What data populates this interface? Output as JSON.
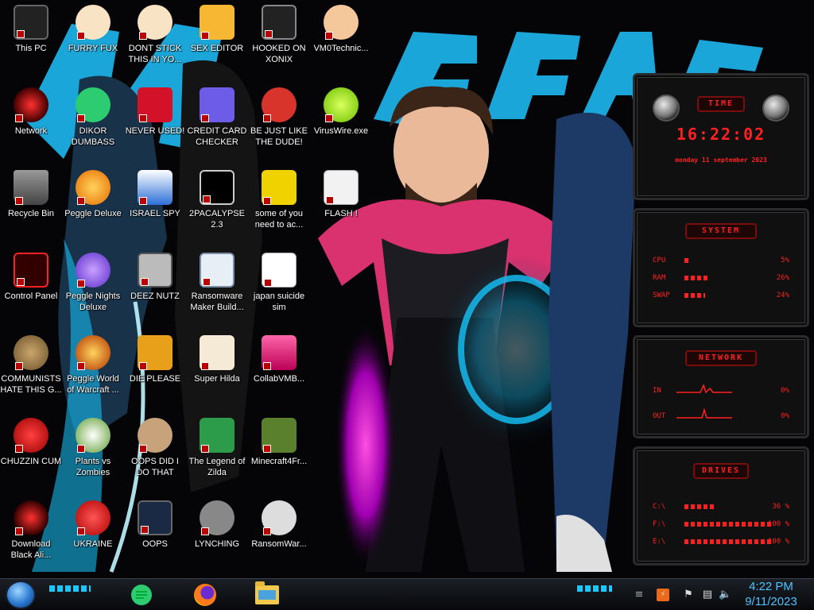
{
  "desktop": {
    "icons": [
      {
        "label": "This PC",
        "icon": "computer-icon"
      },
      {
        "label": "Network",
        "icon": "network-icon"
      },
      {
        "label": "Recycle Bin",
        "icon": "recycle-bin-icon"
      },
      {
        "label": "Control Panel",
        "icon": "control-panel-icon"
      },
      {
        "label": "COMMUNISTS HATE THIS G...",
        "icon": "money-bag-icon"
      },
      {
        "label": "CHUZZIN CUM",
        "icon": "chuzzle-icon"
      },
      {
        "label": "Download Black Ali...",
        "icon": "alien-orb-icon"
      },
      {
        "label": "FURRY FUX",
        "icon": "anime-face-icon"
      },
      {
        "label": "DIKOR DUMBASS",
        "icon": "chat-app-icon"
      },
      {
        "label": "Peggle Deluxe",
        "icon": "peggle-icon"
      },
      {
        "label": "Peggle Nights Deluxe",
        "icon": "peggle-nights-icon"
      },
      {
        "label": "Peggle World of Warcraft ...",
        "icon": "peggle-wow-icon"
      },
      {
        "label": "Plants vs Zombies",
        "icon": "plants-icon"
      },
      {
        "label": "UKRAINE",
        "icon": "radiation-icon"
      },
      {
        "label": "DONT STICK THIS IN YO...",
        "icon": "anime-face-icon"
      },
      {
        "label": "NEVER USED!",
        "icon": "dev-icon"
      },
      {
        "label": "ISRAEL SPY",
        "icon": "spy-icon"
      },
      {
        "label": "DEEZ NUTZ",
        "icon": "windows-stack-icon"
      },
      {
        "label": "DIE PLEASE",
        "icon": "de-icon"
      },
      {
        "label": "OOPS DID I DO THAT",
        "icon": "portrait-icon"
      },
      {
        "label": "OOPS",
        "icon": "monitor-icon"
      },
      {
        "label": "SEX EDITOR",
        "icon": "editor-icon"
      },
      {
        "label": "CREDIT CARD CHECKER",
        "icon": "credit-card-icon"
      },
      {
        "label": "2PACALYPSE 2.3",
        "icon": "terminal-icon"
      },
      {
        "label": "Ransomware Maker Build...",
        "icon": "app-window-icon"
      },
      {
        "label": "Super Hilda",
        "icon": "pixel-icon"
      },
      {
        "label": "The Legend of Zilda",
        "icon": "zelda-icon"
      },
      {
        "label": "LYNCHING",
        "icon": "lynching-icon"
      },
      {
        "label": "HOOKED ON XONIX",
        "icon": "xonix-icon"
      },
      {
        "label": "BE JUST LIKE THE DUDE!",
        "icon": "santa-icon"
      },
      {
        "label": "some of you need to ac...",
        "icon": "bear-icon"
      },
      {
        "label": "japan suicide sim",
        "icon": "file-icon"
      },
      {
        "label": "CollabVMB...",
        "icon": "collab-icon"
      },
      {
        "label": "Minecraft4Fr...",
        "icon": "minecraft-icon"
      },
      {
        "label": "RansomWar...",
        "icon": "skull-icon"
      },
      {
        "label": "VM0Technic...",
        "icon": "technician-icon"
      },
      {
        "label": "VirusWire.exe",
        "icon": "lime-icon"
      },
      {
        "label": "FLASH !",
        "icon": "flash-icon"
      }
    ]
  },
  "widget": {
    "time": {
      "title": "TIME",
      "clock": "16:22:02",
      "date": "monday 11 september 2023"
    },
    "system": {
      "title": "SYSTEM",
      "rows": [
        {
          "label": "CPU",
          "value": "5%",
          "level": 0.05
        },
        {
          "label": "RAM",
          "value": "26%",
          "level": 0.26
        },
        {
          "label": "SWAP",
          "value": "24%",
          "level": 0.24
        }
      ]
    },
    "network": {
      "title": "NETWORK",
      "rows": [
        {
          "label": "IN",
          "value": "0%"
        },
        {
          "label": "OUT",
          "value": "0%"
        }
      ]
    },
    "drives": {
      "title": "DRIVES",
      "rows": [
        {
          "label": "C:\\",
          "value": "36 %",
          "level": 0.36
        },
        {
          "label": "F:\\",
          "value": "100 %",
          "level": 1.0
        },
        {
          "label": "E:\\",
          "value": "100 %",
          "level": 1.0
        }
      ]
    }
  },
  "taskbar": {
    "pinned": [
      {
        "name": "chat-app",
        "icon": "chat-app-icon"
      },
      {
        "name": "firefox",
        "icon": "firefox-icon"
      },
      {
        "name": "file-explorer",
        "icon": "folder-icon"
      }
    ],
    "tray": [
      "show-hidden-icon",
      "flag-icon",
      "network-icon",
      "volume-icon"
    ],
    "clock_time": "4:22 PM",
    "clock_date": "9/11/2023"
  },
  "colors": {
    "accent": "#18c8ff",
    "widget_red": "#ff2020",
    "clock_blue": "#4fc3ff"
  }
}
